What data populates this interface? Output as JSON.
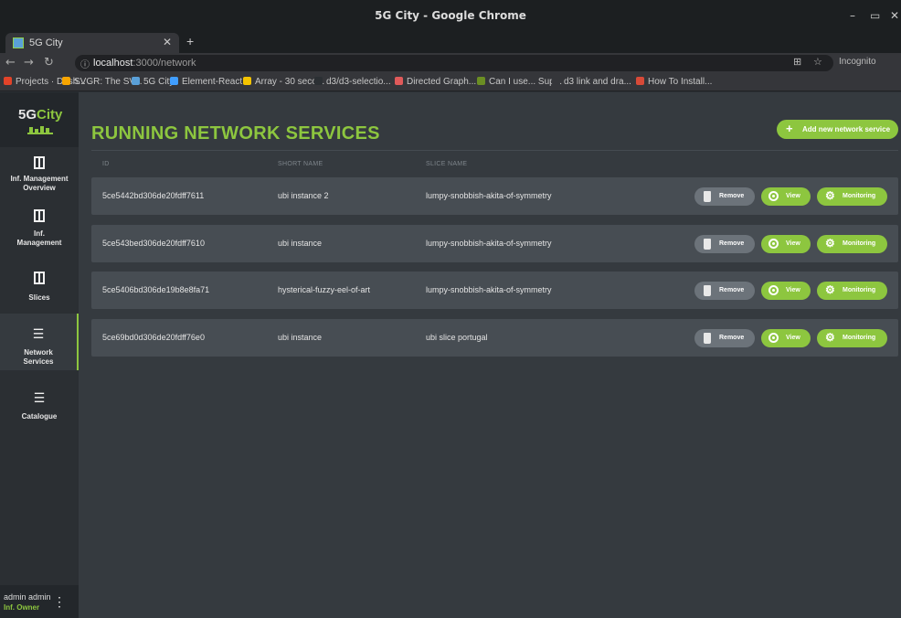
{
  "browser": {
    "window_title": "5G City - Google Chrome",
    "tab_title": "5G City",
    "url_host": "localhost",
    "url_path": ":3000/network",
    "incognito_label": "Incognito",
    "bookmarks": [
      {
        "label": "Projects · Dash...",
        "color": "#e24329"
      },
      {
        "label": "SVGR: The SV...",
        "color": "#f7a500"
      },
      {
        "label": "5G City",
        "color": "#5aa0d8"
      },
      {
        "label": "Element-React",
        "color": "#409eff"
      },
      {
        "label": "Array - 30 seco...",
        "color": "#f5c400"
      },
      {
        "label": "d3/d3-selectio...",
        "color": "#2b2f33"
      },
      {
        "label": "Directed Graph...",
        "color": "#e05a5a"
      },
      {
        "label": "Can I use... Sup...",
        "color": "#6b8e23"
      },
      {
        "label": "d3 link and dra...",
        "color": "#35363a"
      },
      {
        "label": "How To Install...",
        "color": "#d84a38"
      }
    ]
  },
  "app": {
    "logo_text_a": "5G",
    "logo_text_b": "City",
    "nav": [
      {
        "label": "Inf. Management Overview",
        "icon": "map-icon"
      },
      {
        "label": "Inf. Management",
        "icon": "map-icon"
      },
      {
        "label": "Slices",
        "icon": "map-icon"
      },
      {
        "label": "Network Services",
        "icon": "list-icon"
      },
      {
        "label": "Catalogue",
        "icon": "list-icon"
      }
    ],
    "user": {
      "name": "admin admin",
      "role": "Inf. Owner"
    },
    "page_title": "RUNNING NETWORK SERVICES",
    "add_button": "Add new network service",
    "columns": {
      "id": "ID",
      "short_name": "SHORT NAME",
      "slice_name": "SLICE NAME"
    },
    "buttons": {
      "remove": "Remove",
      "view": "View",
      "monitoring": "Monitoring"
    },
    "rows": [
      {
        "id": "5ce5442bd306de20fdff7611",
        "short_name": "ubi instance 2",
        "slice_name": "lumpy-snobbish-akita-of-symmetry"
      },
      {
        "id": "5ce543bed306de20fdff7610",
        "short_name": "ubi instance",
        "slice_name": "lumpy-snobbish-akita-of-symmetry"
      },
      {
        "id": "5ce5406bd306de19b8e8fa71",
        "short_name": "hysterical-fuzzy-eel-of-art",
        "slice_name": "lumpy-snobbish-akita-of-symmetry"
      },
      {
        "id": "5ce69bd0d306de20fdff76e0",
        "short_name": "ubi instance",
        "slice_name": "ubi slice portugal"
      }
    ],
    "accent_color": "#8dc63f"
  }
}
